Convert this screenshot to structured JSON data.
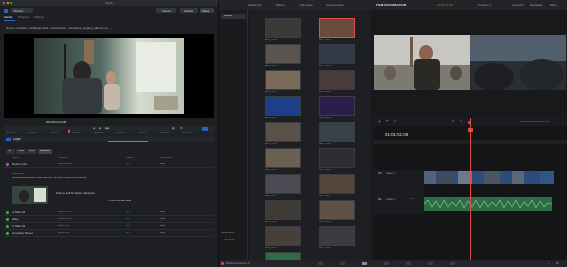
{
  "left_window": {
    "title": "Rush",
    "toolbar": {
      "browse": "Browse",
      "search": "Search",
      "upload": "Upload",
      "share": "Share"
    },
    "tabs": [
      "Media",
      "Projects",
      "Shared"
    ],
    "breadcrumb": "Home › Rushes › Drafting's Hub › Final Draw › memories_singing_sfd2 & me_...",
    "timecode": "00:00:03:18",
    "ruler_ticks": [
      "00:00:00",
      "00:00:05",
      "00:00:10",
      "00:00:15",
      "00:00:20",
      "00:00:25",
      "00:00:30",
      "00:00:35",
      "00:00:40"
    ],
    "clips_title": "Clips",
    "filters": [
      "All",
      "Video",
      "Audio",
      "Selected"
    ],
    "columns": [
      "Name",
      "Duration",
      "Rating",
      "Comments"
    ],
    "rows": [
      {
        "name": "Rush A Cut",
        "duration": "00:00:03:18",
        "rating": "● 4",
        "comments": "view",
        "color": "#c74bd8"
      },
      {
        "name": "A Take 02",
        "duration": "00:00:17:11",
        "rating": "● 3",
        "comments": "view",
        "color": "#3fae49"
      },
      {
        "name": "Alley",
        "duration": "00:00:15:07",
        "rating": "● 2",
        "comments": "view",
        "color": "#3fae49"
      },
      {
        "name": "C Take 02",
        "duration": "00:00:1:08",
        "rating": "● 2",
        "comments": "view",
        "color": "#3fae49"
      },
      {
        "name": "Crossing Street",
        "duration": "00:00:1:07",
        "rating": "● 3",
        "comments": "view",
        "color": "#3fae49"
      }
    ],
    "description_label": "Description",
    "description": "Additional description and notes for this clip's timeline and scene.",
    "note": "Note to self for future reference",
    "drop_label": "This is the Edit Note"
  },
  "right_window": {
    "top_tabs": [
      "Media Pool",
      "Effects",
      "Edit Index",
      "Sound Library",
      "Inspector",
      "Metadata",
      "Mixer"
    ],
    "program_title": "FILM INTEGRATION",
    "program_timecode": "00:01:51:08",
    "program_right": "Timeline 1",
    "pool_label": "Master",
    "thumbnails": [
      "A001_C003",
      "A001_C004",
      "A002_C001",
      "A002_C009",
      "A003_C002",
      "A003_C006",
      "A004_C001",
      "A004_C005",
      "A005_C003",
      "A005_C008",
      "B001_C002",
      "B001_C004",
      "B002_C001",
      "B002_C007",
      "B003_C003",
      "B003_C005",
      "B004_C002",
      "B004_C006",
      "Audio 1"
    ],
    "timeline_timecode": "01:01:51:08",
    "tracks": {
      "v1": "V1",
      "v1_name": "Video 1",
      "a1": "A1",
      "a1_name": "Audio 1",
      "a1_level": "2.0"
    },
    "smart_bins": "Smart Bins",
    "keywords": "Keywords",
    "project_name": "DaVinci Resolve 17"
  },
  "colors": {
    "accent_red": "#e04a45",
    "video_clip": "#2c4d77",
    "audio_clip": "#2f6b45",
    "clip_green": "#3fae49"
  }
}
